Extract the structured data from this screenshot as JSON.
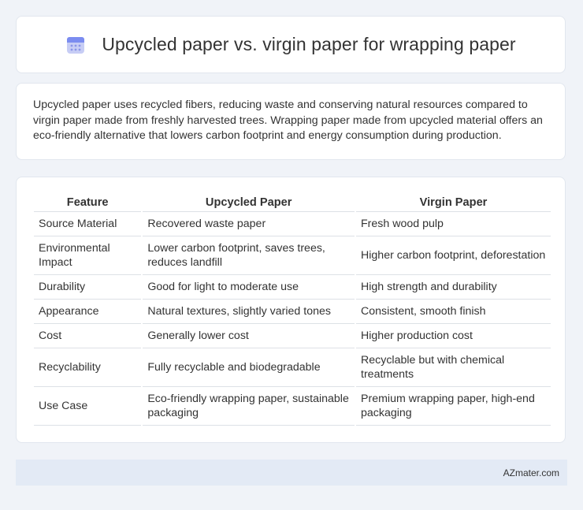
{
  "header": {
    "icon": "calendar-icon",
    "title": "Upcycled paper vs. virgin paper for wrapping paper"
  },
  "intro": {
    "text": "Upcycled paper uses recycled fibers, reducing waste and conserving natural resources compared to virgin paper made from freshly harvested trees. Wrapping paper made from upcycled material offers an eco-friendly alternative that lowers carbon footprint and energy consumption during production."
  },
  "table": {
    "headers": [
      "Feature",
      "Upcycled Paper",
      "Virgin Paper"
    ],
    "rows": [
      [
        "Source Material",
        "Recovered waste paper",
        "Fresh wood pulp"
      ],
      [
        "Environmental Impact",
        "Lower carbon footprint, saves trees, reduces landfill",
        "Higher carbon footprint, deforestation"
      ],
      [
        "Durability",
        "Good for light to moderate use",
        "High strength and durability"
      ],
      [
        "Appearance",
        "Natural textures, slightly varied tones",
        "Consistent, smooth finish"
      ],
      [
        "Cost",
        "Generally lower cost",
        "Higher production cost"
      ],
      [
        "Recyclability",
        "Fully recyclable and biodegradable",
        "Recyclable but with chemical treatments"
      ],
      [
        "Use Case",
        "Eco-friendly wrapping paper, sustainable packaging",
        "Premium wrapping paper, high-end packaging"
      ]
    ]
  },
  "footer": {
    "text": "AZmater.com"
  },
  "colors": {
    "page_background": "#f0f3f8",
    "card_background": "#ffffff",
    "footer_background": "#e3eaf5",
    "icon_accent": "#7b8cf0"
  }
}
